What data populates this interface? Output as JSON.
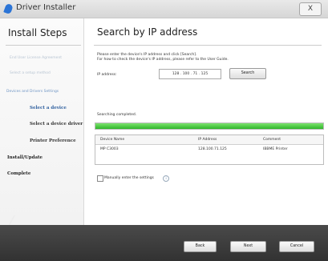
{
  "window": {
    "title": "Driver Installer",
    "close_label": "X"
  },
  "sidebar": {
    "title": "Install Steps",
    "steps": [
      {
        "label": "End User License Agreement"
      },
      {
        "label": "Select a setup method"
      },
      {
        "label": "Devices and Drivers Settings"
      },
      {
        "label": "Select a device"
      },
      {
        "label": "Select a device driver"
      },
      {
        "label": "Printer Preference"
      },
      {
        "label": "Install/Update"
      },
      {
        "label": "Complete"
      }
    ]
  },
  "main": {
    "title": "Search by IP address",
    "instructions": [
      "Please enter the device's IP address and click [Search].",
      "For how to check the device's IP address, please refer to the User Guide."
    ],
    "ip_label": "IP address:",
    "ip_value": "128 . 100 . 71 . 125",
    "search_label": "Search",
    "status": "Searching completed.",
    "progress_percent": 100,
    "table": {
      "columns": [
        "Device Name",
        "IP Address",
        "Comment"
      ],
      "rows": [
        [
          "MP C3003",
          "128.100.71.125",
          "IBBME Printer"
        ]
      ]
    },
    "manual_label": "Manually enter the settings",
    "manual_checked": false,
    "info_glyph": "i"
  },
  "footer": {
    "back_label": "Back",
    "next_label": "Next",
    "cancel_label": "Cancel"
  },
  "colors": {
    "progress": "#2fb52a",
    "current_step": "#2e5f9e"
  },
  "icons": [
    "driver-installer-icon",
    "close-icon",
    "info-icon"
  ]
}
